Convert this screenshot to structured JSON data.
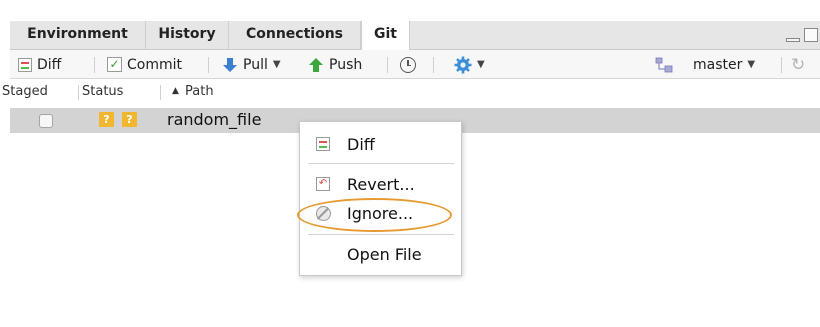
{
  "tabs": [
    {
      "label": "Environment",
      "active": false
    },
    {
      "label": "History",
      "active": false
    },
    {
      "label": "Connections",
      "active": false
    },
    {
      "label": "Git",
      "active": true
    }
  ],
  "toolbar": {
    "diff_label": "Diff",
    "commit_label": "Commit",
    "pull_label": "Pull",
    "push_label": "Push",
    "branch_label": "master",
    "icons": [
      "diff-icon",
      "commit-icon",
      "pull-arrow-icon",
      "push-arrow-icon",
      "history-clock-icon",
      "gear-icon",
      "branch-icon",
      "refresh-icon"
    ]
  },
  "columns": {
    "staged": "Staged",
    "status": "Status",
    "path": "Path",
    "sort_indicator": "▲"
  },
  "files": [
    {
      "staged": false,
      "status": [
        "?",
        "?"
      ],
      "path": "random_file"
    }
  ],
  "context_menu": {
    "items": [
      {
        "label": "Diff",
        "icon": "diff-icon"
      },
      {
        "label": "Revert...",
        "icon": "revert-icon"
      },
      {
        "label": "Ignore...",
        "icon": "ignore-icon",
        "highlighted": true
      },
      {
        "label": "Open File",
        "icon": ""
      }
    ]
  },
  "colors": {
    "status_badge": "#f3b631",
    "pull_arrow": "#3a7fd0",
    "push_arrow": "#3aa83a",
    "highlight_ellipse": "#e69a32",
    "selected_row": "#d3d3d3"
  }
}
